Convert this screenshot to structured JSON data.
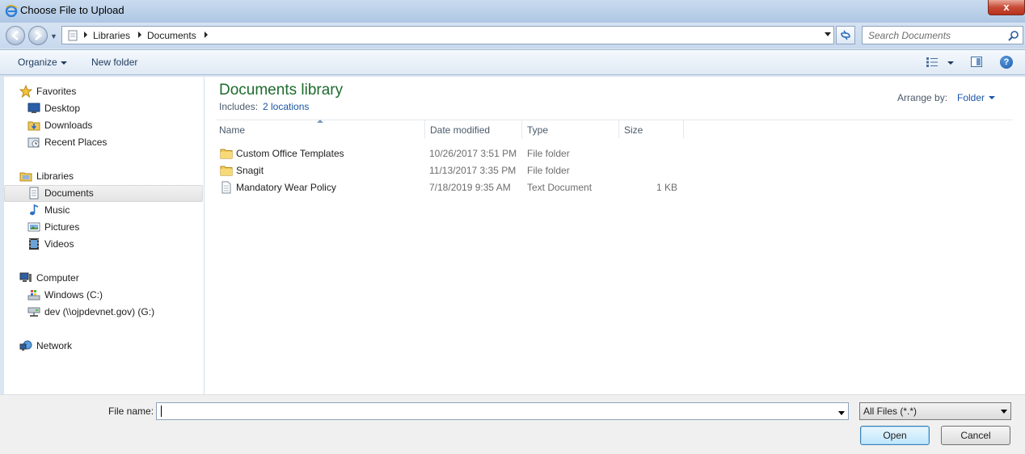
{
  "window": {
    "title": "Choose File to Upload",
    "close_label": "x"
  },
  "address": {
    "breadcrumbs": [
      "Libraries",
      "Documents"
    ],
    "search_placeholder": "Search Documents"
  },
  "toolbar": {
    "organize_label": "Organize",
    "new_folder_label": "New folder"
  },
  "nav": {
    "items": [
      {
        "label": "Favorites",
        "icon": "star-icon"
      },
      {
        "label": "Desktop",
        "icon": "desktop-icon"
      },
      {
        "label": "Downloads",
        "icon": "downloads-folder-icon"
      },
      {
        "label": "Recent Places",
        "icon": "recent-places-icon"
      },
      {
        "label": "Libraries",
        "icon": "libraries-icon"
      },
      {
        "label": "Documents",
        "icon": "documents-icon",
        "selected": true
      },
      {
        "label": "Music",
        "icon": "music-icon"
      },
      {
        "label": "Pictures",
        "icon": "pictures-icon"
      },
      {
        "label": "Videos",
        "icon": "videos-icon"
      },
      {
        "label": "Computer",
        "icon": "computer-icon"
      },
      {
        "label": "Windows (C:)",
        "icon": "drive-icon"
      },
      {
        "label": "dev (\\\\ojpdevnet.gov) (G:)",
        "icon": "network-drive-icon"
      },
      {
        "label": "Network",
        "icon": "network-icon"
      }
    ]
  },
  "content": {
    "library_title": "Documents library",
    "includes_label": "Includes:",
    "includes_link": "2 locations",
    "arrange_label": "Arrange by:",
    "arrange_value": "Folder",
    "columns": [
      "Name",
      "Date modified",
      "Type",
      "Size"
    ],
    "files": [
      {
        "name": "Custom Office Templates",
        "date": "10/26/2017 3:51 PM",
        "type": "File folder",
        "size": "",
        "icon": "folder-icon"
      },
      {
        "name": "Snagit",
        "date": "11/13/2017 3:35 PM",
        "type": "File folder",
        "size": "",
        "icon": "folder-icon"
      },
      {
        "name": "Mandatory Wear Policy",
        "date": "7/18/2019 9:35 AM",
        "type": "Text Document",
        "size": "1 KB",
        "icon": "text-file-icon"
      }
    ]
  },
  "bottom": {
    "file_name_label": "File name:",
    "file_name_value": "",
    "file_type_value": "All Files (*.*)",
    "open_label": "Open",
    "cancel_label": "Cancel"
  }
}
